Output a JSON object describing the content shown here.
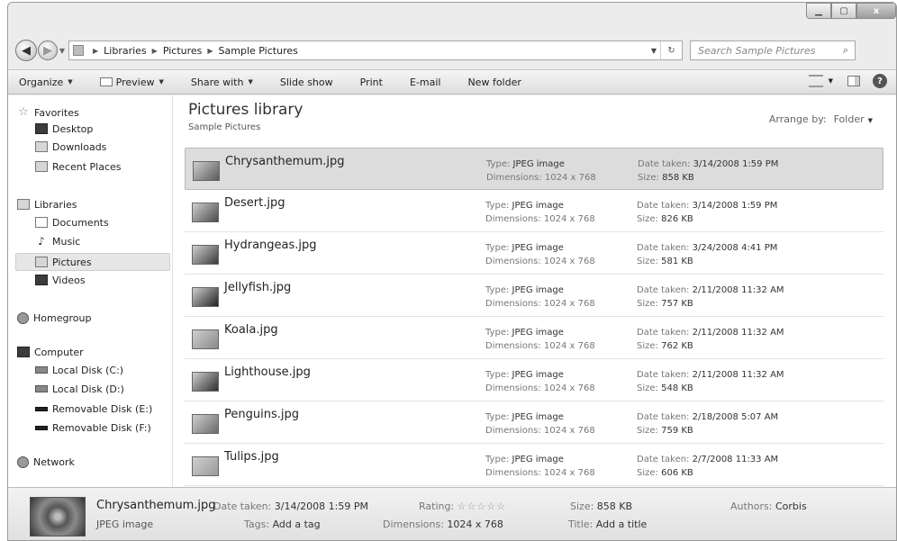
{
  "address": {
    "crumbs": [
      "Libraries",
      "Pictures",
      "Sample Pictures"
    ],
    "search_placeholder": "Search Sample Pictures"
  },
  "toolbar": {
    "organize": "Organize",
    "preview": "Preview",
    "share_with": "Share with",
    "slide_show": "Slide show",
    "print": "Print",
    "email": "E-mail",
    "new_folder": "New folder"
  },
  "nav": {
    "favorites": "Favorites",
    "desktop": "Desktop",
    "downloads": "Downloads",
    "recent_places": "Recent Places",
    "libraries": "Libraries",
    "documents": "Documents",
    "music": "Music",
    "pictures": "Pictures",
    "videos": "Videos",
    "homegroup": "Homegroup",
    "computer": "Computer",
    "local_c": "Local Disk (C:)",
    "local_d": "Local Disk (D:)",
    "removable_e": "Removable Disk (E:)",
    "removable_f": "Removable Disk (F:)",
    "network": "Network"
  },
  "library": {
    "title": "Pictures library",
    "subtitle": "Sample Pictures",
    "arrange_label": "Arrange by:",
    "arrange_value": "Folder"
  },
  "labels": {
    "type": "Type:",
    "dimensions": "Dimensions:",
    "date_taken": "Date taken:",
    "size": "Size:"
  },
  "files": [
    {
      "name": "Chrysanthemum.jpg",
      "type": "JPEG image",
      "dimensions": "1024 x 768",
      "date": "3/14/2008 1:59 PM",
      "size": "858 KB",
      "thumb": "#5a5a5a"
    },
    {
      "name": "Desert.jpg",
      "type": "JPEG image",
      "dimensions": "1024 x 768",
      "date": "3/14/2008 1:59 PM",
      "size": "826 KB",
      "thumb": "#4a4a4a"
    },
    {
      "name": "Hydrangeas.jpg",
      "type": "JPEG image",
      "dimensions": "1024 x 768",
      "date": "3/24/2008 4:41 PM",
      "size": "581 KB",
      "thumb": "#3a3a3a"
    },
    {
      "name": "Jellyfish.jpg",
      "type": "JPEG image",
      "dimensions": "1024 x 768",
      "date": "2/11/2008 11:32 AM",
      "size": "757 KB",
      "thumb": "#222222"
    },
    {
      "name": "Koala.jpg",
      "type": "JPEG image",
      "dimensions": "1024 x 768",
      "date": "2/11/2008 11:32 AM",
      "size": "762 KB",
      "thumb": "#8a8a8a"
    },
    {
      "name": "Lighthouse.jpg",
      "type": "JPEG image",
      "dimensions": "1024 x 768",
      "date": "2/11/2008 11:32 AM",
      "size": "548 KB",
      "thumb": "#2e2e2e"
    },
    {
      "name": "Penguins.jpg",
      "type": "JPEG image",
      "dimensions": "1024 x 768",
      "date": "2/18/2008 5:07 AM",
      "size": "759 KB",
      "thumb": "#6a6a6a"
    },
    {
      "name": "Tulips.jpg",
      "type": "JPEG image",
      "dimensions": "1024 x 768",
      "date": "2/7/2008 11:33 AM",
      "size": "606 KB",
      "thumb": "#9a9a9a"
    }
  ],
  "details": {
    "name": "Chrysanthemum.jpg",
    "type": "JPEG image",
    "date_label": "Date taken:",
    "date": "3/14/2008 1:59 PM",
    "tags_label": "Tags:",
    "tags": "Add a tag",
    "rating_label": "Rating:",
    "rating_stars": "☆☆☆☆☆",
    "dimensions_label": "Dimensions:",
    "dimensions": "1024 x 768",
    "size_label": "Size:",
    "size": "858 KB",
    "title_label": "Title:",
    "title": "Add a title",
    "authors_label": "Authors:",
    "authors": "Corbis"
  }
}
